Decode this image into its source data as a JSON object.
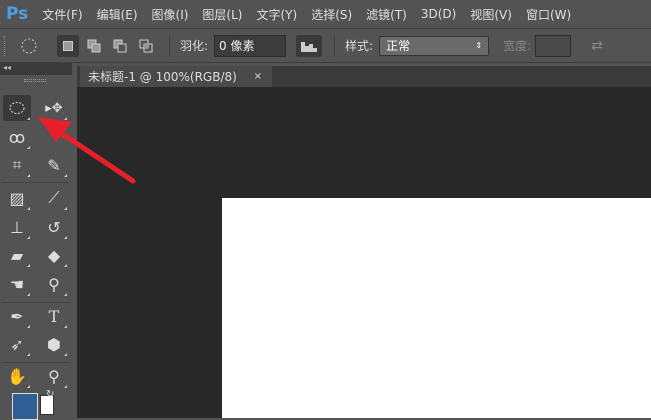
{
  "app": {
    "logo": "Ps"
  },
  "menu": [
    "文件(F)",
    "编辑(E)",
    "图像(I)",
    "图层(L)",
    "文字(Y)",
    "选择(S)",
    "滤镜(T)",
    "3D(D)",
    "视图(V)",
    "窗口(W)"
  ],
  "options": {
    "feather_label": "羽化:",
    "feather_value": "0 像素",
    "style_label": "样式:",
    "style_value": "正常",
    "width_label": "宽度:"
  },
  "panel": {
    "collapse": "◂◂"
  },
  "document": {
    "tab_title": "未标题-1 @ 100%(RGB/8)",
    "close": "×"
  },
  "colors": {
    "foreground": "#2f5f95",
    "background": "#ffffff",
    "arrow": "#e8202a"
  }
}
